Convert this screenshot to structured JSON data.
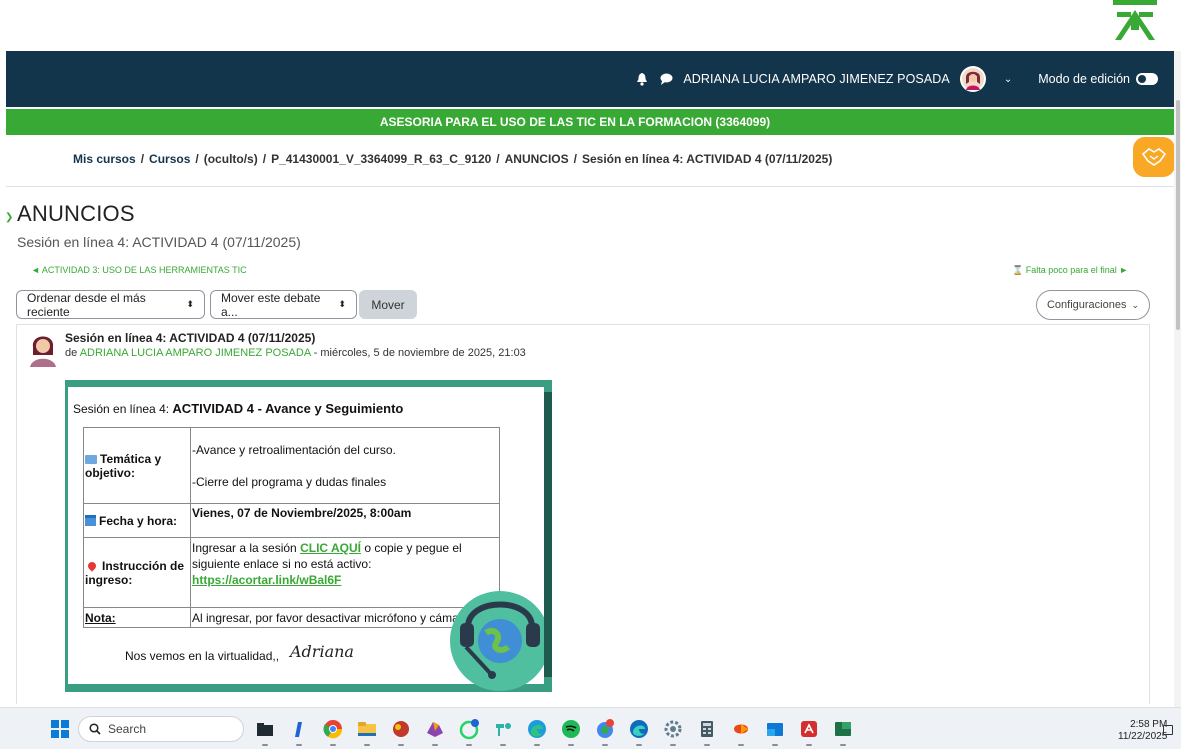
{
  "navbar": {
    "user_name": "ADRIANA LUCIA AMPARO JIMENEZ POSADA",
    "edit_mode_label": "Modo de edición"
  },
  "course_bar": {
    "title": "ASESORIA PARA EL USO DE LAS TIC EN LA FORMACION (3364099)"
  },
  "breadcrumb": {
    "items": [
      "Mis cursos",
      "Cursos",
      "(oculto/s)",
      "P_41430001_V_3364099_R_63_C_9120",
      "ANUNCIOS",
      "Sesión en línea 4: ACTIVIDAD 4 (07/11/2025)"
    ],
    "separator": "/"
  },
  "page": {
    "title": "ANUNCIOS",
    "subtitle": "Sesión en línea 4: ACTIVIDAD 4 (07/11/2025)",
    "prev_link": "◄ ACTIVIDAD 3: USO DE LAS HERRAMIENTAS TIC",
    "next_link": "Falta poco para el final ►"
  },
  "controls": {
    "sort_label": "Ordenar desde el más reciente",
    "move_select_label": "Mover este debate a...",
    "move_button": "Mover",
    "settings_button": "Configuraciones"
  },
  "post": {
    "title": "Sesión en línea 4: ACTIVIDAD 4 (07/11/2025)",
    "by_prefix": "de",
    "author": "ADRIANA LUCIA AMPARO JIMENEZ POSADA",
    "date": "- miércoles, 5 de noviembre de 2025, 21:03"
  },
  "flyer": {
    "heading_prefix": "Sesión en línea 4:",
    "heading_main": "ACTIVIDAD 4 -  Avance y Seguimiento",
    "rows": {
      "tematica_key": "Temática y objetivo:",
      "tematica_line1": "-Avance y retroalimentación del curso.",
      "tematica_line2": "-Cierre del programa y dudas finales",
      "fecha_key": "Fecha y hora:",
      "fecha_value": "Vienes, 07 de Noviembre/2025, 8:00am",
      "instr_key": "Instrucción de ingreso:",
      "instr_text1": "Ingresar a la sesión",
      "instr_link": "CLIC AQUÍ",
      "instr_text2": "o copie y pegue el siguiente enlace si no está activo:",
      "instr_url": "https://acortar.link/wBal6F",
      "nota_key": "Nota:",
      "nota_value": "Al ingresar, por favor desactivar micrófono y cámara"
    },
    "closing": "Nos vemos en la virtualidad,,",
    "signature": "Adriana"
  },
  "taskbar": {
    "search_placeholder": "Search",
    "time": "2:58 PM",
    "date": "11/22/2025",
    "icons": [
      "file-explorer-icon",
      "edge-icon",
      "chrome-icon",
      "folder-icon",
      "game-icon",
      "copilot-icon",
      "whatsapp-icon",
      "teams-icon",
      "edge-profile-icon",
      "spotify-icon",
      "chrome-profile-icon",
      "edge-dev-icon",
      "settings-icon",
      "calculator-icon",
      "office-icon",
      "outlook-icon",
      "acrobat-icon",
      "excel-icon"
    ]
  },
  "colors": {
    "navbar_bg": "#13354b",
    "accent_green": "#39a935",
    "help_orange": "#f9a825"
  }
}
